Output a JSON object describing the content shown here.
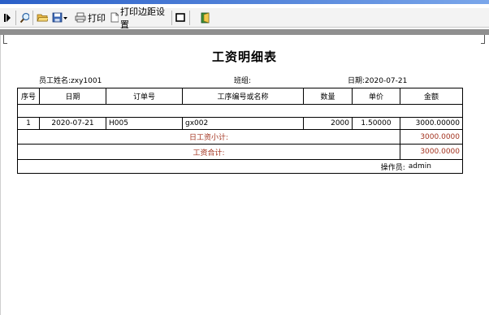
{
  "toolbar": {
    "print_label": "打印",
    "margin_label": "打印边距设置"
  },
  "report": {
    "title": "工资明细表",
    "employee_label": "员工姓名:",
    "employee_value": "zxy1001",
    "group_label": "班组:",
    "group_value": "",
    "date_label": "日期:",
    "date_value": "2020-07-21",
    "columns": [
      "序号",
      "日期",
      "订单号",
      "工序编号或名称",
      "数量",
      "单价",
      "金额"
    ],
    "rows": [
      {
        "no": "1",
        "date": "2020-07-21",
        "order": "H005",
        "process": "gx002",
        "qty": "2000",
        "price": "1.50000",
        "amount": "3000.00000"
      }
    ],
    "daily_subtotal_label": "日工资小计:",
    "daily_subtotal_value": "3000.0000",
    "wage_total_label": "工资合计:",
    "wage_total_value": "3000.0000",
    "operator_label": "操作员:",
    "operator_value": "admin"
  },
  "colors": {
    "titlebar": "#2a5fc8",
    "toolbar_bg": "#f3f3f3",
    "band_gray": "#8f8f8f",
    "total_red": "#a3331f"
  }
}
